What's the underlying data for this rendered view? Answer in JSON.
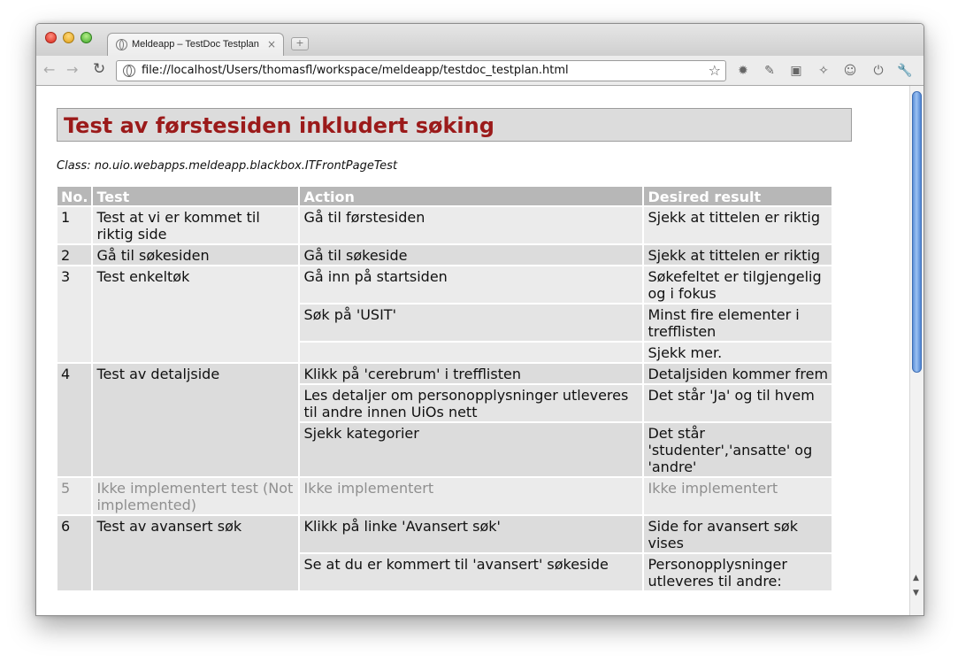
{
  "browser": {
    "tab_title": "Meldeapp – TestDoc Testplan",
    "tab_close": "×",
    "new_tab": "+",
    "url": "file://localhost/Users/thomasfl/workspace/meldeapp/testdoc_testplan.html",
    "back_glyph": "←",
    "forward_glyph": "→",
    "reload_glyph": "↻",
    "star_glyph": "☆",
    "extensions": [
      "gear-icon",
      "eyedropper-icon",
      "tag-icon",
      "palette-icon",
      "emoji-icon",
      "power-icon",
      "wrench-icon"
    ]
  },
  "page": {
    "heading": "Test av førstesiden inkludert søking",
    "class_line": "Class: no.uio.webapps.meldeapp.blackbox.ITFrontPageTest",
    "columns": [
      "No.",
      "Test",
      "Action",
      "Desired result"
    ],
    "heading_color": "#9b1a1a",
    "tests": [
      {
        "no": "1",
        "test": "Test at vi er kommet til riktig side",
        "implemented": true,
        "steps": [
          {
            "action": "Gå til førstesiden",
            "result": "Sjekk at tittelen er riktig"
          }
        ]
      },
      {
        "no": "2",
        "test": "Gå til søkesiden",
        "implemented": true,
        "steps": [
          {
            "action": "Gå til søkeside",
            "result": "Sjekk at tittelen er riktig"
          }
        ]
      },
      {
        "no": "3",
        "test": "Test enkeltøk",
        "implemented": true,
        "steps": [
          {
            "action": "Gå inn på startsiden",
            "result": "Søkefeltet er tilgjengelig og i fokus"
          },
          {
            "action": "Søk på 'USIT'",
            "result": "Minst fire elementer i trefflisten"
          },
          {
            "action": "",
            "result": "Sjekk mer."
          }
        ]
      },
      {
        "no": "4",
        "test": "Test av detaljside",
        "implemented": true,
        "steps": [
          {
            "action": "Klikk på 'cerebrum' i trefflisten",
            "result": "Detaljsiden kommer frem"
          },
          {
            "action": "Les detaljer om personopplysninger utleveres til andre innen UiOs nett",
            "result": "Det står 'Ja' og til hvem"
          },
          {
            "action": "Sjekk kategorier",
            "result": "Det står 'studenter','ansatte' og 'andre'"
          }
        ]
      },
      {
        "no": "5",
        "test": "Ikke implementert test (Not implemented)",
        "implemented": false,
        "steps": [
          {
            "action": "Ikke implementert",
            "result": "Ikke implementert"
          }
        ]
      },
      {
        "no": "6",
        "test": "Test av avansert søk",
        "implemented": true,
        "steps": [
          {
            "action": "Klikk på linke 'Avansert søk'",
            "result": "Side for avansert søk vises"
          },
          {
            "action": "Se at du er kommert til 'avansert' søkeside",
            "result": "Personopplysninger utleveres til andre:"
          }
        ]
      }
    ]
  }
}
